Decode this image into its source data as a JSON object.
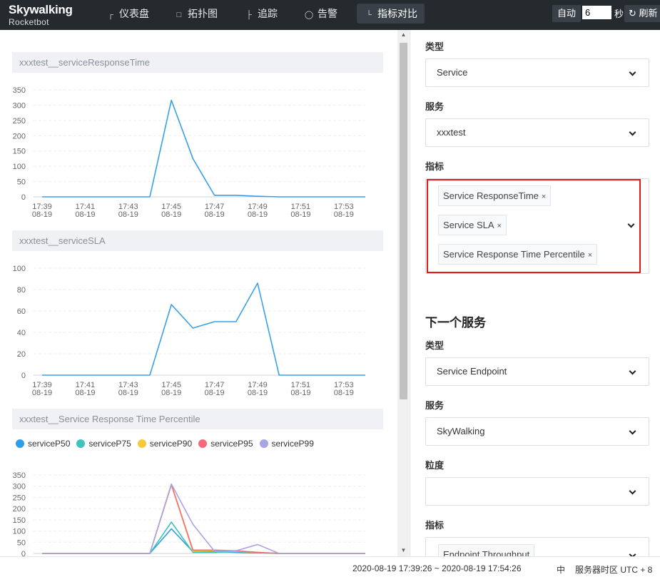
{
  "app": {
    "brand": "Skywalking",
    "subtitle": "Rocketbot"
  },
  "nav": [
    {
      "label": "仪表盘",
      "icon": "dashboard-icon"
    },
    {
      "label": "拓扑图",
      "icon": "topology-icon"
    },
    {
      "label": "追踪",
      "icon": "trace-icon"
    },
    {
      "label": "告警",
      "icon": "alarm-icon"
    },
    {
      "label": "指标对比",
      "icon": "comparison-icon",
      "active": true
    }
  ],
  "toolbar": {
    "auto_label": "自动",
    "interval_value": "6",
    "seconds_label": "秒",
    "refresh_label": "刷新",
    "refresh_icon": "refresh-icon"
  },
  "charts": [
    {
      "title": "xxxtest__serviceResponseTime"
    },
    {
      "title": "xxxtest__serviceSLA"
    },
    {
      "title": "xxxtest__Service Response Time Percentile"
    }
  ],
  "chart_data": [
    {
      "type": "line",
      "title": "xxxtest__serviceResponseTime",
      "x": [
        "17:39",
        "17:40",
        "17:41",
        "17:42",
        "17:43",
        "17:44",
        "17:45",
        "17:46",
        "17:47",
        "17:48",
        "17:49",
        "17:50",
        "17:51",
        "17:52",
        "17:53",
        "17:54"
      ],
      "tick_labels": [
        [
          "17:39",
          "08-19"
        ],
        [
          "17:41",
          "08-19"
        ],
        [
          "17:43",
          "08-19"
        ],
        [
          "17:45",
          "08-19"
        ],
        [
          "17:47",
          "08-19"
        ],
        [
          "17:49",
          "08-19"
        ],
        [
          "17:51",
          "08-19"
        ],
        [
          "17:53",
          "08-19"
        ]
      ],
      "yticks": [
        0,
        50,
        100,
        150,
        200,
        250,
        300,
        350
      ],
      "ylim": [
        0,
        350
      ],
      "series": [
        {
          "color": "#3aa0e6",
          "values": [
            0,
            0,
            0,
            0,
            0,
            0,
            316,
            125,
            5,
            5,
            2,
            0,
            0,
            0,
            0,
            0
          ]
        }
      ]
    },
    {
      "type": "line",
      "title": "xxxtest__serviceSLA",
      "x": [
        "17:39",
        "17:40",
        "17:41",
        "17:42",
        "17:43",
        "17:44",
        "17:45",
        "17:46",
        "17:47",
        "17:48",
        "17:49",
        "17:50",
        "17:51",
        "17:52",
        "17:53",
        "17:54"
      ],
      "tick_labels": [
        [
          "17:39",
          "08-19"
        ],
        [
          "17:41",
          "08-19"
        ],
        [
          "17:43",
          "08-19"
        ],
        [
          "17:45",
          "08-19"
        ],
        [
          "17:47",
          "08-19"
        ],
        [
          "17:49",
          "08-19"
        ],
        [
          "17:51",
          "08-19"
        ],
        [
          "17:53",
          "08-19"
        ]
      ],
      "yticks": [
        0,
        20,
        40,
        60,
        80,
        100
      ],
      "ylim": [
        0,
        100
      ],
      "series": [
        {
          "color": "#3aa0e6",
          "values": [
            0,
            0,
            0,
            0,
            0,
            0,
            66,
            44,
            50,
            50,
            86,
            0,
            0,
            0,
            0,
            0
          ]
        }
      ]
    },
    {
      "type": "line",
      "title": "xxxtest__Service Response Time Percentile",
      "x": [
        "17:39",
        "17:40",
        "17:41",
        "17:42",
        "17:43",
        "17:44",
        "17:45",
        "17:46",
        "17:47",
        "17:48",
        "17:49",
        "17:50",
        "17:51",
        "17:52",
        "17:53",
        "17:54"
      ],
      "yticks": [
        0,
        50,
        100,
        150,
        200,
        250,
        300,
        350
      ],
      "ylim": [
        0,
        350
      ],
      "legend_position": "top-left",
      "series": [
        {
          "name": "serviceP50",
          "color": "#2e9ee8",
          "values": [
            0,
            0,
            0,
            0,
            0,
            0,
            110,
            8,
            8,
            5,
            3,
            0,
            0,
            0,
            0,
            0
          ]
        },
        {
          "name": "serviceP75",
          "color": "#3fc2b8",
          "values": [
            0,
            0,
            0,
            0,
            0,
            0,
            140,
            5,
            5,
            8,
            5,
            0,
            0,
            0,
            0,
            0
          ]
        },
        {
          "name": "serviceP90",
          "color": "#f8c93b",
          "values": [
            0,
            0,
            0,
            0,
            0,
            0,
            305,
            10,
            12,
            10,
            5,
            0,
            0,
            0,
            0,
            0
          ]
        },
        {
          "name": "serviceP95",
          "color": "#f56b7a",
          "values": [
            0,
            0,
            0,
            0,
            0,
            0,
            308,
            15,
            15,
            12,
            5,
            0,
            0,
            0,
            0,
            0
          ]
        },
        {
          "name": "serviceP99",
          "color": "#a7a5e3",
          "values": [
            0,
            0,
            0,
            0,
            0,
            0,
            310,
            130,
            10,
            12,
            40,
            0,
            0,
            0,
            0,
            0
          ]
        }
      ]
    }
  ],
  "form": {
    "type_label": "类型",
    "type_value": "Service",
    "service_label": "服务",
    "service_value": "xxxtest",
    "metrics_label": "指标",
    "metrics_tags": [
      "Service ResponseTime",
      "Service SLA",
      "Service Response Time Percentile"
    ],
    "next_title": "下一个服务",
    "next_type_label": "类型",
    "next_type_value": "Service Endpoint",
    "next_service_label": "服务",
    "next_service_value": "SkyWalking",
    "granularity_label": "粒度",
    "granularity_value": "",
    "next_metrics_label": "指标",
    "next_metrics_tag": "Endpoint Throughput"
  },
  "footer": {
    "time_range": "2020-08-19 17:39:26 ~ 2020-08-19 17:54:26",
    "lang": "中",
    "timezone": "服务器时区 UTC + 8"
  }
}
